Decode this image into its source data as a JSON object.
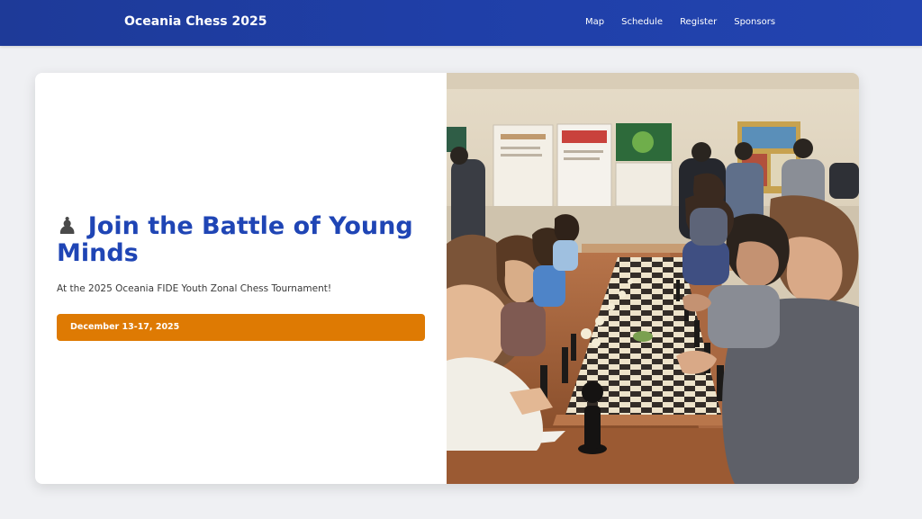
{
  "header": {
    "brand": "Oceania Chess 2025",
    "nav": [
      {
        "label": "Map"
      },
      {
        "label": "Schedule"
      },
      {
        "label": "Register"
      },
      {
        "label": "Sponsors"
      }
    ]
  },
  "hero": {
    "icon": "♟",
    "title": "Join the Battle of Young Minds",
    "subtitle": "At the 2025 Oceania FIDE Youth Zonal Chess Tournament!",
    "date_label": "December 13-17, 2025",
    "image_icon": "chess-tournament-photo"
  },
  "colors": {
    "header": "#1f3fa8",
    "title": "#1f45b5",
    "date_button": "#de7a03",
    "page_bg": "#eff0f3"
  }
}
